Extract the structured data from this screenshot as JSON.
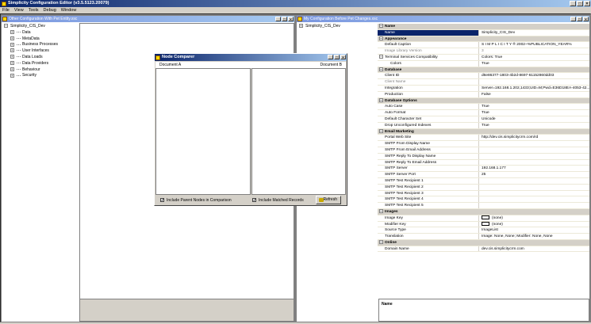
{
  "app": {
    "title": "Simplicity Configuration Editor (v3.5.5123.20079)",
    "window_buttons": [
      "_",
      "□",
      "×"
    ]
  },
  "menu": [
    "File",
    "View",
    "Tools",
    "Debug",
    "Window"
  ],
  "left_pane": {
    "title": "Other Configuration With Pet Entity.xsc",
    "root": "Simplicity_CIS_Dev",
    "root_expander": "−",
    "child_expander": "+",
    "children": [
      "Data",
      "MetaData",
      "Business Processes",
      "User Interfaces",
      "Data Loads",
      "Data Providers",
      "Behaviour",
      "Security"
    ]
  },
  "right_pane": {
    "title": "My Configuration Before Pet Changes.xsc",
    "root": "Simplicity_CIS_Dev",
    "root_expander": "+"
  },
  "property_grid": {
    "description_title": "Name",
    "rows": [
      {
        "type": "cat",
        "key": "Name"
      },
      {
        "type": "prop",
        "key": "Name",
        "val": "Simplicity_CIS_Dev"
      },
      {
        "type": "cat",
        "key": "Appearance"
      },
      {
        "type": "prop",
        "key": "Default Caption",
        "val": "S I M P L I C I T Y ® 2002~%PUBLICATION_YEAR%"
      },
      {
        "type": "prop-dis",
        "key": "Image Library Version",
        "val": "3"
      },
      {
        "type": "prop",
        "key": "Terminal Services Compatibility",
        "val": "Colors: True",
        "exp": "−"
      },
      {
        "type": "prop-indent",
        "key": "Colors",
        "val": "True"
      },
      {
        "type": "cat",
        "key": "Database"
      },
      {
        "type": "prop",
        "key": "Client ID",
        "val": "d6e86377-1803-4b2d-8697-61152860dd03"
      },
      {
        "type": "prop-dis",
        "key": "Client Name",
        "val": ""
      },
      {
        "type": "prop",
        "key": "Integration",
        "val": "Server=192.168.1.202,1433;UID=M;Pwd=E36D18EA-4053-42..."
      },
      {
        "type": "prop",
        "key": "Production",
        "val": "False"
      },
      {
        "type": "cat",
        "key": "Database Options"
      },
      {
        "type": "prop",
        "key": "Auto Case",
        "val": "True"
      },
      {
        "type": "prop",
        "key": "Auto Format",
        "val": "True"
      },
      {
        "type": "prop",
        "key": "Default Character Set",
        "val": "Unicode"
      },
      {
        "type": "prop",
        "key": "Drop Unconfigured Indexes",
        "val": "True"
      },
      {
        "type": "cat",
        "key": "Email Marketing"
      },
      {
        "type": "prop",
        "key": "Portal Web Site",
        "val": "http://dev.cis.simplicitycrm.com/rd"
      },
      {
        "type": "prop",
        "key": "SMTP From Display Name",
        "val": ""
      },
      {
        "type": "prop",
        "key": "SMTP From Email Address",
        "val": ""
      },
      {
        "type": "prop",
        "key": "SMTP Reply To Display Name",
        "val": ""
      },
      {
        "type": "prop",
        "key": "SMTP Reply To Email Address",
        "val": ""
      },
      {
        "type": "prop",
        "key": "SMTP Server",
        "val": "192.168.1.177"
      },
      {
        "type": "prop",
        "key": "SMTP Server Port",
        "val": "25"
      },
      {
        "type": "prop",
        "key": "SMTP Test Recipient 1",
        "val": ""
      },
      {
        "type": "prop",
        "key": "SMTP Test Recipient 2",
        "val": ""
      },
      {
        "type": "prop",
        "key": "SMTP Test Recipient 3",
        "val": ""
      },
      {
        "type": "prop",
        "key": "SMTP Test Recipient 4",
        "val": ""
      },
      {
        "type": "prop",
        "key": "SMTP Test Recipient 5",
        "val": ""
      },
      {
        "type": "cat",
        "key": "Images"
      },
      {
        "type": "prop-swatch",
        "key": "Image Key",
        "val": "(none)"
      },
      {
        "type": "prop-swatch",
        "key": "Modifier Key",
        "val": "(none)"
      },
      {
        "type": "prop",
        "key": "Source Type",
        "val": "ImageList"
      },
      {
        "type": "prop",
        "key": "Translation",
        "val": "Image: None, None; Modifier: None, None"
      },
      {
        "type": "cat",
        "key": "Online"
      },
      {
        "type": "prop",
        "key": "Domain Name",
        "val": "dev.cis.simplicitycrm.com"
      }
    ]
  },
  "dialog": {
    "title": "Node Comparer",
    "doc_a": "Document A",
    "doc_b": "Document B",
    "check_parent": "Include Parent Nodes in Comparison",
    "check_matched": "Include Matched Records",
    "check_mark": "✔",
    "refresh": "Refresh"
  }
}
